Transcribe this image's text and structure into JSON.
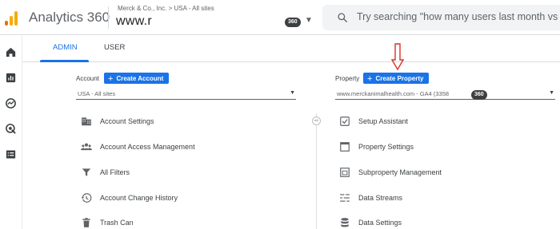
{
  "header": {
    "app_title": "Analytics 360",
    "breadcrumb": "Merck & Co., Inc. > USA - All sites",
    "property_name": "www.r",
    "badge": "360",
    "search_placeholder": "Try searching \"how many users last month vs last"
  },
  "tabs": [
    {
      "label": "ADMIN",
      "active": true
    },
    {
      "label": "USER",
      "active": false
    }
  ],
  "account": {
    "label": "Account",
    "create_button": "Create Account",
    "selector_value": "USA - All sites",
    "items": [
      {
        "label": "Account Settings",
        "icon": "building-icon"
      },
      {
        "label": "Account Access Management",
        "icon": "people-icon"
      },
      {
        "label": "All Filters",
        "icon": "filter-icon"
      },
      {
        "label": "Account Change History",
        "icon": "history-icon"
      },
      {
        "label": "Trash Can",
        "icon": "trash-icon"
      }
    ]
  },
  "property": {
    "label": "Property",
    "create_button": "Create Property",
    "selector_value": "www.merckanimalhealth.com - GA4 (3358",
    "selector_badge": "360",
    "items": [
      {
        "label": "Setup Assistant",
        "icon": "checkbox-icon"
      },
      {
        "label": "Property Settings",
        "icon": "settings-window-icon"
      },
      {
        "label": "Subproperty Management",
        "icon": "subproperty-icon"
      },
      {
        "label": "Data Streams",
        "icon": "data-streams-icon"
      },
      {
        "label": "Data Settings",
        "icon": "database-icon"
      }
    ]
  },
  "colors": {
    "accent": "#1a73e8",
    "annotation_arrow": "#d93025"
  }
}
